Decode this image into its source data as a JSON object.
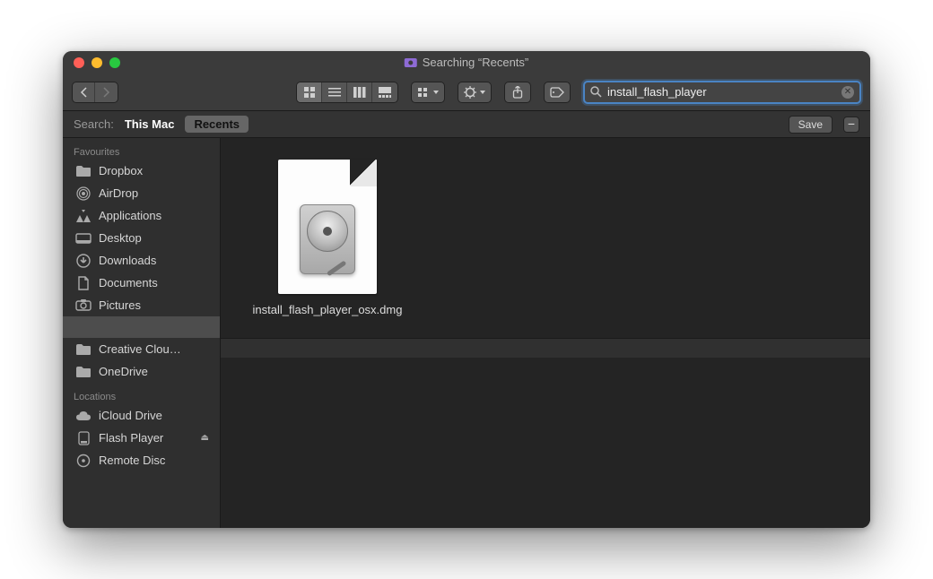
{
  "titlebar": {
    "title": "Searching “Recents”"
  },
  "toolbar": {
    "search_value": "install_flash_player"
  },
  "scopebar": {
    "label": "Search:",
    "this_mac": "This Mac",
    "recents": "Recents",
    "save": "Save",
    "minus": "−"
  },
  "sidebar": {
    "favourites_heading": "Favourites",
    "favourites": [
      {
        "label": "Dropbox",
        "icon": "folder"
      },
      {
        "label": "AirDrop",
        "icon": "airdrop"
      },
      {
        "label": "Applications",
        "icon": "apps"
      },
      {
        "label": "Desktop",
        "icon": "desktop"
      },
      {
        "label": "Downloads",
        "icon": "downloads"
      },
      {
        "label": "Documents",
        "icon": "documents"
      },
      {
        "label": "Pictures",
        "icon": "pictures"
      },
      {
        "label": "",
        "icon": "blank",
        "selected": true
      },
      {
        "label": "Creative Clou…",
        "icon": "folder"
      },
      {
        "label": "OneDrive",
        "icon": "folder"
      }
    ],
    "locations_heading": "Locations",
    "locations": [
      {
        "label": "iCloud Drive",
        "icon": "icloud"
      },
      {
        "label": "Flash Player",
        "icon": "disk",
        "eject": true
      },
      {
        "label": "Remote Disc",
        "icon": "optical"
      }
    ]
  },
  "results": {
    "items": [
      {
        "name": "install_flash_player_osx.dmg"
      }
    ]
  }
}
